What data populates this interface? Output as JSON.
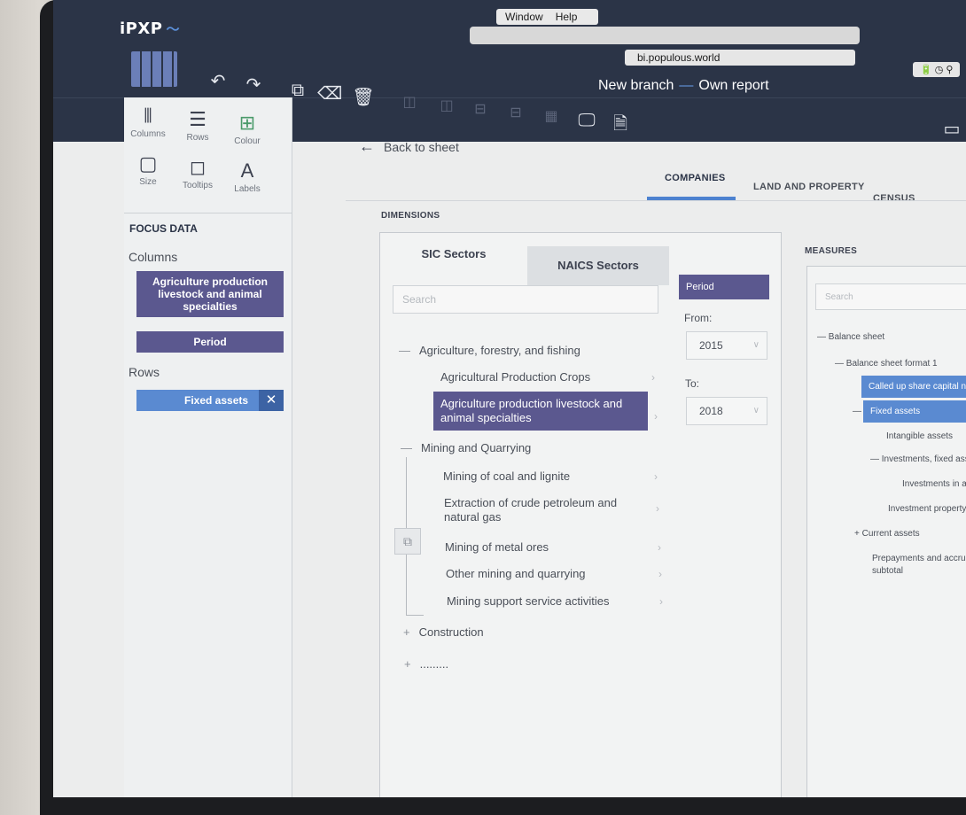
{
  "app": {
    "logo": "iPXP",
    "mac_menu": [
      "Window",
      "Help"
    ],
    "url": "bi.populous.world",
    "report_title": "New branch",
    "report_subtitle": "Own report"
  },
  "left_tools": [
    {
      "icon": "columns-icon",
      "label": "Columns",
      "glyph": "⦀"
    },
    {
      "icon": "rows-icon",
      "label": "Rows",
      "glyph": "☰"
    },
    {
      "icon": "colour-icon",
      "label": "Colour",
      "glyph": "⊞"
    },
    {
      "icon": "size-icon",
      "label": "Size",
      "glyph": "▢"
    },
    {
      "icon": "tooltips-icon",
      "label": "Tooltips",
      "glyph": "◻"
    },
    {
      "icon": "labels-icon",
      "label": "Labels",
      "glyph": "A"
    }
  ],
  "focus": {
    "heading": "FOCUS DATA",
    "columns_label": "Columns",
    "column_chips": [
      "Agriculture production livestock and animal specialties",
      "Period"
    ],
    "rows_label": "Rows",
    "row_chips": [
      "Fixed assets"
    ],
    "remove_glyph": "✕"
  },
  "nav": {
    "back": "Back to sheet",
    "tabs": [
      "COMPANIES",
      "LAND AND PROPERTY",
      "CENSUS"
    ]
  },
  "dimensions": {
    "label": "DIMENSIONS",
    "tabs": [
      "SIC Sectors",
      "NAICS Sectors"
    ],
    "search_placeholder": "Search",
    "tree": [
      {
        "sign": "—",
        "text": "Agriculture, forestry, and fishing"
      },
      {
        "sign": "",
        "text": "Agricultural Production Crops"
      },
      {
        "sign": "",
        "text": "Agriculture production livestock and animal specialties"
      },
      {
        "sign": "—",
        "text": "Mining and Quarrying"
      },
      {
        "sign": "",
        "text": "Mining of coal and lignite"
      },
      {
        "sign": "",
        "text": "Extraction of crude petroleum and natural gas"
      },
      {
        "sign": "",
        "text": "Mining of metal ores"
      },
      {
        "sign": "",
        "text": "Other mining and quarrying"
      },
      {
        "sign": "",
        "text": "Mining support service activities"
      },
      {
        "sign": "+",
        "text": "Construction"
      },
      {
        "sign": "+",
        "text": "........."
      }
    ]
  },
  "period": {
    "button": "Period",
    "from_label": "From:",
    "from_value": "2015",
    "to_label": "To:",
    "to_value": "2018"
  },
  "measures": {
    "label": "MEASURES",
    "search_placeholder": "Search",
    "tree": [
      {
        "sign": "—",
        "text": "Balance sheet"
      },
      {
        "sign": "—",
        "text": "Balance sheet format 1"
      },
      {
        "sign": "",
        "text": "Called up share capital not paid, not expressed"
      },
      {
        "sign": "—",
        "text": "Fixed assets"
      },
      {
        "sign": "",
        "text": "Intangible assets"
      },
      {
        "sign": "—",
        "text": "Investments, fixed assets"
      },
      {
        "sign": "",
        "text": "Investments in associates and joint"
      },
      {
        "sign": "",
        "text": "Investment property"
      },
      {
        "sign": "+",
        "text": "Current assets"
      },
      {
        "sign": "",
        "text": "Prepayments and accrued income, not expr"
      },
      {
        "sign": "",
        "text": "subtotal"
      }
    ]
  },
  "colors": {
    "topbar": "#2b3447",
    "accent_purple": "#5b588f",
    "accent_blue": "#5a8ad1",
    "tab_underline": "#4d82d0"
  }
}
